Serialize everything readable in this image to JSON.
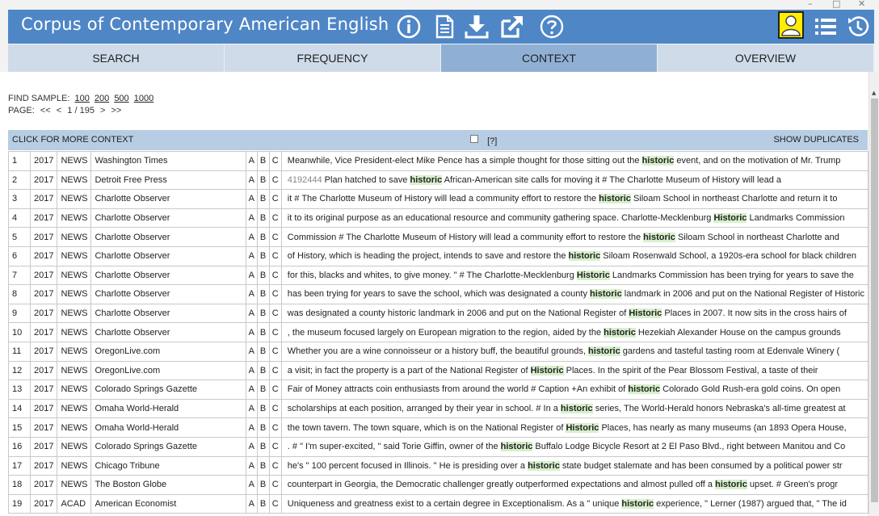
{
  "app": {
    "title": "Corpus of Contemporary American English"
  },
  "window_controls": [
    "–",
    "□",
    "✕"
  ],
  "header_icons": [
    "info-icon",
    "document-icon",
    "download-icon",
    "external-link-icon",
    "help-icon",
    "user-icon",
    "list-icon",
    "history-icon"
  ],
  "tabs": [
    {
      "label": "SEARCH"
    },
    {
      "label": "FREQUENCY"
    },
    {
      "label": "CONTEXT",
      "active": true
    },
    {
      "label": "OVERVIEW"
    }
  ],
  "find_sample": {
    "label": "FIND SAMPLE:",
    "options": [
      "100",
      "200",
      "500",
      "1000"
    ]
  },
  "page": {
    "label": "PAGE:",
    "first": "<<",
    "prev": "<",
    "current": "1 / 195",
    "next": ">",
    "last": ">>"
  },
  "context_bar": {
    "more": "CLICK FOR MORE CONTEXT",
    "help": "[?]",
    "duplicates": "SHOW DUPLICATES"
  },
  "highlight_color": "#d7f0cc",
  "rows": [
    {
      "n": "1",
      "year": "2017",
      "genre": "NEWS",
      "source": "Washington Times",
      "a": "A",
      "b": "B",
      "c": "C",
      "pre": "Meanwhile, Vice President-elect Mike Pence has a simple thought for those sitting out the ",
      "kw": "historic",
      "post": " event, and on the motivation of Mr. Trump"
    },
    {
      "n": "2",
      "year": "2017",
      "genre": "NEWS",
      "source": "Detroit Free Press",
      "a": "A",
      "b": "B",
      "c": "C",
      "id": "4192444",
      "pre": " Plan hatched to save ",
      "kw": "historic",
      "post": " African-American site calls for moving it # The Charlotte Museum of History will lead a"
    },
    {
      "n": "3",
      "year": "2017",
      "genre": "NEWS",
      "source": "Charlotte Observer",
      "a": "A",
      "b": "B",
      "c": "C",
      "pre": "it # The Charlotte Museum of History will lead a community effort to restore the ",
      "kw": "historic",
      "post": " Siloam School in northeast Charlotte and return it to"
    },
    {
      "n": "4",
      "year": "2017",
      "genre": "NEWS",
      "source": "Charlotte Observer",
      "a": "A",
      "b": "B",
      "c": "C",
      "pre": "it to its original purpose as an educational resource and community gathering space. Charlotte-Mecklenburg ",
      "kw": "Historic",
      "post": " Landmarks Commission"
    },
    {
      "n": "5",
      "year": "2017",
      "genre": "NEWS",
      "source": "Charlotte Observer",
      "a": "A",
      "b": "B",
      "c": "C",
      "pre": "Commission # The Charlotte Museum of History will lead a community effort to restore the ",
      "kw": "historic",
      "post": " Siloam School in northeast Charlotte and"
    },
    {
      "n": "6",
      "year": "2017",
      "genre": "NEWS",
      "source": "Charlotte Observer",
      "a": "A",
      "b": "B",
      "c": "C",
      "pre": "of History, which is heading the project, intends to save and restore the ",
      "kw": "historic",
      "post": " Siloam Rosenwald School, a 1920s-era school for black children"
    },
    {
      "n": "7",
      "year": "2017",
      "genre": "NEWS",
      "source": "Charlotte Observer",
      "a": "A",
      "b": "B",
      "c": "C",
      "pre": "for this, blacks and whites, to give money. \" # The Charlotte-Mecklenburg ",
      "kw": "Historic",
      "post": " Landmarks Commission has been trying for years to save the"
    },
    {
      "n": "8",
      "year": "2017",
      "genre": "NEWS",
      "source": "Charlotte Observer",
      "a": "A",
      "b": "B",
      "c": "C",
      "pre": "has been trying for years to save the school, which was designated a county ",
      "kw": "historic",
      "post": " landmark in 2006 and put on the National Register of Historic"
    },
    {
      "n": "9",
      "year": "2017",
      "genre": "NEWS",
      "source": "Charlotte Observer",
      "a": "A",
      "b": "B",
      "c": "C",
      "pre": "was designated a county historic landmark in 2006 and put on the National Register of ",
      "kw": "Historic",
      "post": " Places in 2007. It now sits in the cross hairs of"
    },
    {
      "n": "10",
      "year": "2017",
      "genre": "NEWS",
      "source": "Charlotte Observer",
      "a": "A",
      "b": "B",
      "c": "C",
      "pre": ", the museum focused largely on European migration to the region, aided by the ",
      "kw": "historic",
      "post": " Hezekiah Alexander House on the campus grounds"
    },
    {
      "n": "11",
      "year": "2017",
      "genre": "NEWS",
      "source": "OregonLive.com",
      "a": "A",
      "b": "B",
      "c": "C",
      "pre": "Whether you are a wine connoisseur or a history buff, the beautiful grounds, ",
      "kw": "historic",
      "post": " gardens and tasteful tasting room at Edenvale Winery ("
    },
    {
      "n": "12",
      "year": "2017",
      "genre": "NEWS",
      "source": "OregonLive.com",
      "a": "A",
      "b": "B",
      "c": "C",
      "pre": "a visit; in fact the property is a part of the National Register of ",
      "kw": "Historic",
      "post": " Places. In the spirit of the Pear Blossom Festival, a taste of their"
    },
    {
      "n": "13",
      "year": "2017",
      "genre": "NEWS",
      "source": "Colorado Springs Gazette",
      "a": "A",
      "b": "B",
      "c": "C",
      "pre": "Fair of Money attracts coin enthusiasts from around the world # Caption +An exhibit of ",
      "kw": "historic",
      "post": " Colorado Gold Rush-era gold coins. On open"
    },
    {
      "n": "14",
      "year": "2017",
      "genre": "NEWS",
      "source": "Omaha World-Herald",
      "a": "A",
      "b": "B",
      "c": "C",
      "pre": "scholarships at each position, arranged by their year in school. # In a ",
      "kw": "historic",
      "post": " series, The World-Herald honors Nebraska's all-time greatest at"
    },
    {
      "n": "15",
      "year": "2017",
      "genre": "NEWS",
      "source": "Omaha World-Herald",
      "a": "A",
      "b": "B",
      "c": "C",
      "pre": "the town tavern. The town square, which is on the National Register of ",
      "kw": "Historic",
      "post": " Places, has nearly as many museums (an 1893 Opera House,"
    },
    {
      "n": "16",
      "year": "2017",
      "genre": "NEWS",
      "source": "Colorado Springs Gazette",
      "a": "A",
      "b": "B",
      "c": "C",
      "pre": ". # \" I'm super-excited, \" said Torie Giffin, owner of the ",
      "kw": "historic",
      "post": " Buffalo Lodge Bicycle Resort at 2 El Paso Blvd., right between Manitou and Co"
    },
    {
      "n": "17",
      "year": "2017",
      "genre": "NEWS",
      "source": "Chicago Tribune",
      "a": "A",
      "b": "B",
      "c": "C",
      "pre": "he's \" 100 percent focused in Illinois. \" He is presiding over a ",
      "kw": "historic",
      "post": " state budget stalemate and has been consumed by a political power str"
    },
    {
      "n": "18",
      "year": "2017",
      "genre": "NEWS",
      "source": "The Boston Globe",
      "a": "A",
      "b": "B",
      "c": "C",
      "pre": "counterpart in Georgia, the Democratic challenger greatly outperformed expectations and almost pulled off a ",
      "kw": "historic",
      "post": " upset. # Green's progr"
    },
    {
      "n": "19",
      "year": "2017",
      "genre": "ACAD",
      "source": "American Economist",
      "a": "A",
      "b": "B",
      "c": "C",
      "pre": "Uniqueness and greatness exist to a certain degree in Exceptionalism. As a \" unique ",
      "kw": "historic",
      "post": " experience, \" Lerner (1987) argued that, \" The id"
    }
  ]
}
